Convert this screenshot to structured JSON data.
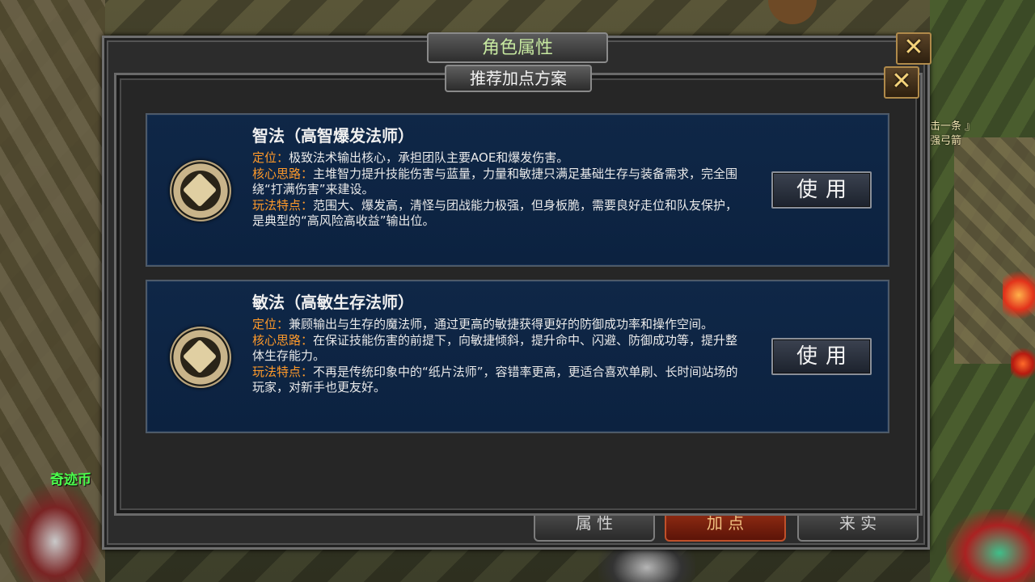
{
  "window": {
    "title": "角色属性",
    "close_label": "✕",
    "bottom_tabs": [
      {
        "label": "属 性",
        "active": false
      },
      {
        "label": "加 点",
        "active": true
      },
      {
        "label": "来 实",
        "active": false
      }
    ]
  },
  "dialog": {
    "title": "推荐加点方案",
    "close_label": "✕"
  },
  "plans": [
    {
      "title": "智法（高智爆发法师）",
      "icon": "mage-emblem-icon",
      "position_label": "定位：",
      "position_text": "极致法术输出核心，承担团队主要AOE和爆发伤害。",
      "core_label": "核心思路：",
      "core_text": "主堆智力提升技能伤害与蓝量，力量和敏捷只满足基础生存与装备需求，完全围绕“打满伤害”来建设。",
      "feature_label": "玩法特点：",
      "feature_text": "范围大、爆发高，清怪与团战能力极强，但身板脆，需要良好走位和队友保护，是典型的“高风险高收益”输出位。",
      "button_label": "使用"
    },
    {
      "title": "敏法（高敏生存法师）",
      "icon": "mage-emblem-icon",
      "position_label": "定位：",
      "position_text": "兼顾输出与生存的魔法师，通过更高的敏捷获得更好的防御成功率和操作空间。",
      "core_label": "核心思路：",
      "core_text": "在保证技能伤害的前提下，向敏捷倾斜，提升命中、闪避、防御成功等，提升整体生存能力。",
      "feature_label": "玩法特点：",
      "feature_text": "不再是传统印象中的“纸片法师”，容错率更高，更适合喜欢单刷、长时间站场的玩家，对新手也更友好。",
      "button_label": "使用"
    }
  ],
  "world": {
    "currency_label": "奇迹币",
    "side_text_1": "击一条 』",
    "side_text_2": "强弓箭"
  }
}
